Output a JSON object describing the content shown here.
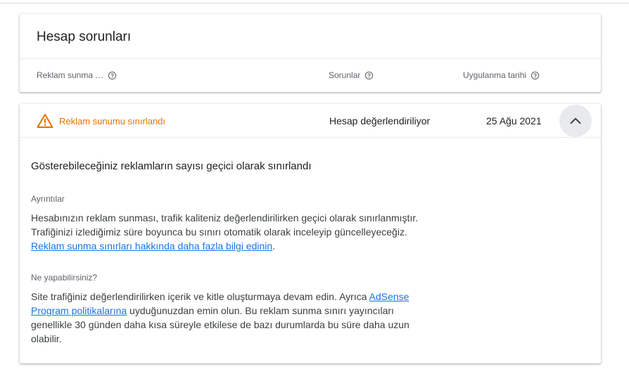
{
  "summary": {
    "title": "Hesap sorunları",
    "columns": [
      {
        "label": "Reklam sunma …"
      },
      {
        "label": "Sorunlar"
      },
      {
        "label": "Uygulanma tarihi"
      }
    ]
  },
  "issue": {
    "name": "Reklam sunumu sınırlandı",
    "status": "Hesap değerlendiriliyor",
    "date": "25 Ağu 2021",
    "detail_title": "Gösterebileceğiniz reklamların sayısı geçici olarak sınırlandı",
    "details_label": "Ayrıntılar",
    "details_line1": "Hesabınızın reklam sunması, trafik kaliteniz değerlendirilirken geçici olarak sınırlanmıştır.",
    "details_line2": "Trafiğinizi izlediğimiz süre boyunca bu sınırı otomatik olarak inceleyip güncelleyeceğiz.",
    "details_link": "Reklam sunma sınırları hakkında daha fazla bilgi edinin",
    "details_link_suffix": ".",
    "actions_label": "Ne yapabilirsiniz?",
    "actions_text_pre": "Site trafiğiniz değerlendirilirken içerik ve kitle oluşturmaya devam edin. Ayrıca ",
    "actions_link": "AdSense Program politikalarına",
    "actions_text_post": " uyduğunuzdan emin olun. Bu reklam sunma sınırı yayıncıları genellikle 30 günden daha kısa süreyle etkilese de bazı durumlarda bu süre daha uzun olabilir."
  },
  "colors": {
    "warning": "#e37400",
    "link": "#1a73e8"
  },
  "icons": {
    "help": "help-circle-icon",
    "warning": "warning-triangle-icon",
    "collapse": "chevron-up-icon"
  }
}
